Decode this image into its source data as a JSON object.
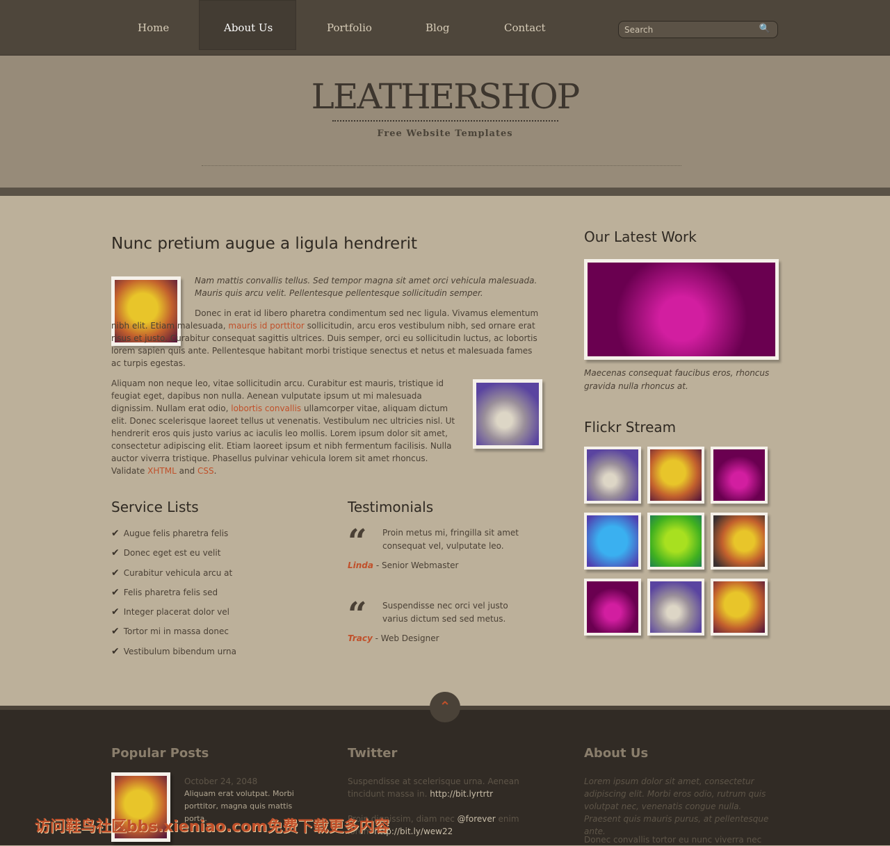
{
  "nav": {
    "items": [
      "Home",
      "About Us",
      "Portfolio",
      "Blog",
      "Contact"
    ],
    "active": "About Us",
    "search_placeholder": "Search"
  },
  "header": {
    "logo": "LEATHERSHOP",
    "tagline": "Free Website Templates"
  },
  "main": {
    "title": "Nunc pretium augue a ligula hendrerit",
    "intro": "Nam mattis convallis tellus. Sed tempor magna sit amet orci vehicula malesuada. Mauris quis arcu velit. Pellentesque pellentesque sollicitudin semper.",
    "p1_a": "Donec in erat id libero pharetra condimentum sed nec ligula. Vivamus elementum nibh elit. Etiam malesuada, ",
    "p1_link": "mauris id porttitor",
    "p1_b": " sollicitudin, arcu eros vestibulum nibh, sed ornare erat risus et justo. Curabitur consequat sagittis ultrices. Duis semper, orci eu sollicitudin luctus, ac lobortis lorem sapien quis ante. Pellentesque habitant morbi tristique senectus et netus et malesuada fames ac turpis egestas.",
    "p2_a": "Aliquam non neque leo, vitae sollicitudin arcu. Curabitur est mauris, tristique id feugiat eget, dapibus non nulla. Aenean vulputate ipsum ut mi malesuada dignissim. Nullam erat odio, ",
    "p2_link": "lobortis convallis",
    "p2_b": " ullamcorper vitae, aliquam dictum elit. Donec scelerisque laoreet tellus ut venenatis. Vestibulum nec ultricies nisl. Ut hendrerit eros quis justo varius ac iaculis leo mollis. Lorem ipsum dolor sit amet, consectetur adipiscing elit. Etiam laoreet ipsum et nibh fermentum facilisis. Nulla auctor viverra tristique. Phasellus pulvinar vehicula lorem sit amet rhoncus. Validate ",
    "xhtml": "XHTML",
    "and": " and ",
    "css": "CSS",
    "end": "."
  },
  "services": {
    "title": "Service Lists",
    "items": [
      "Augue felis pharetra felis",
      "Donec eget est eu velit",
      "Curabitur vehicula arcu at",
      "Felis pharetra felis sed",
      "Integer placerat dolor vel",
      "Tortor mi in massa donec",
      "Vestibulum bibendum urna"
    ]
  },
  "testimonials": {
    "title": "Testimonials",
    "items": [
      {
        "text": "Proin metus mi, fringilla sit amet consequat vel, vulputate leo.",
        "name": "Linda",
        "role": " - Senior Webmaster"
      },
      {
        "text": "Suspendisse nec orci vel justo varius dictum sed sed metus.",
        "name": "Tracy",
        "role": " - Web Designer"
      }
    ]
  },
  "sidebar": {
    "latest_title": "Our Latest Work",
    "latest_caption": "Maecenas consequat faucibus eros, rhoncus gravida nulla rhoncus at.",
    "flickr_title": "Flickr Stream"
  },
  "footer": {
    "popular_title": "Popular Posts",
    "post_date": "October 24, 2048",
    "post_text": "Aliquam erat volutpat. Morbi porttitor, magna quis mattis porta.",
    "twitter_title": "Twitter",
    "tweet1": "Suspendisse at scelerisque urna. Aenean tincidunt massa in. ",
    "tweet1_link": "http://bit.lyrtrtr",
    "tweet2_a": "Proin dignissim, diam nec ",
    "tweet2_at": "@forever",
    "tweet2_b": " enim lorem ",
    "tweet2_link": "http://bit.ly/wew22",
    "about_title": "About Us",
    "about_text": "Lorem ipsum dolor sit amet, consectetur adipiscing elit. Morbi eros odio, rutrum quis volutpat nec, venenatis congue nulla. Praesent quis mauris purus, at pellentesque ante.",
    "about_text2": "Donec convallis tortor eu nunc viverra nec"
  },
  "watermark": "访问鞋鸟社区bbs.xieniao.com免费下载更多内容"
}
